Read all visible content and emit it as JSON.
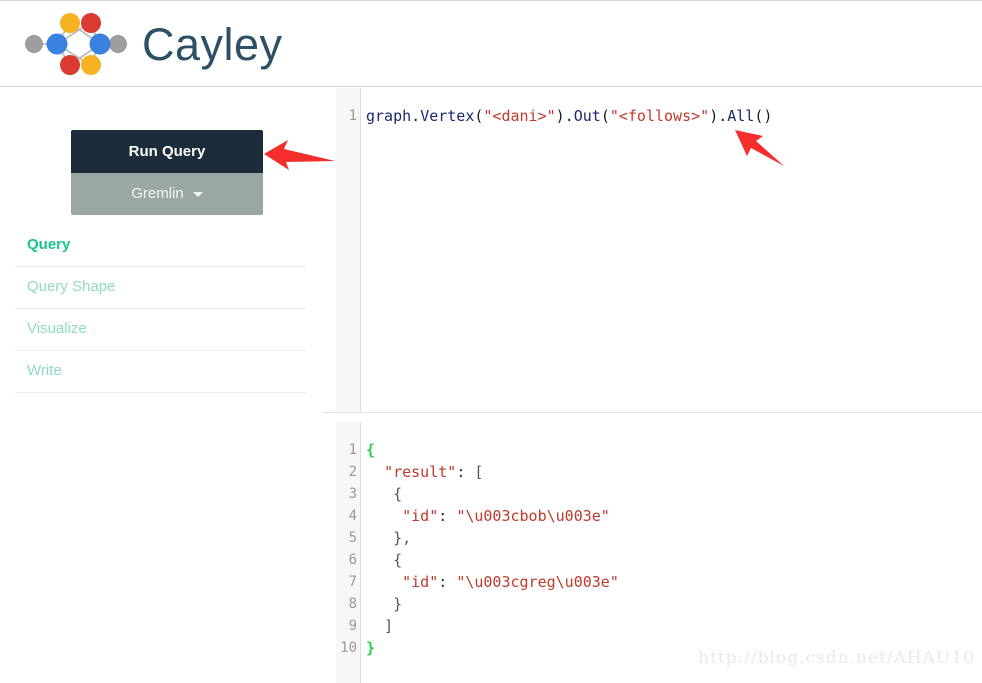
{
  "header": {
    "brand_title": "Cayley",
    "logo_name": "cayley-graph-logo",
    "logo_colors": {
      "blue": "#3b82e0",
      "red": "#d93b30",
      "yellow": "#f5b324",
      "gray": "#9e9e9e",
      "edge": "#b5b5b5"
    }
  },
  "sidebar": {
    "run_query_label": "Run Query",
    "language_label": "Gremlin",
    "language_caret_icon": "chevron-down-icon",
    "nav": [
      {
        "label": "Query",
        "active": true
      },
      {
        "label": "Query Shape",
        "active": false
      },
      {
        "label": "Visualize",
        "active": false
      },
      {
        "label": "Write",
        "active": false
      }
    ]
  },
  "query_editor": {
    "line_numbers": [
      "1"
    ],
    "text": "graph.Vertex(\"<dani>\").Out(\"<follows>\").All()",
    "tokens": [
      {
        "t": "graph",
        "c": "tok-id"
      },
      {
        "t": ".",
        "c": "tok-punc"
      },
      {
        "t": "Vertex",
        "c": "tok-id"
      },
      {
        "t": "(",
        "c": "tok-punc"
      },
      {
        "t": "\"<dani>\"",
        "c": "tok-str"
      },
      {
        "t": ")",
        "c": "tok-punc"
      },
      {
        "t": ".",
        "c": "tok-punc"
      },
      {
        "t": "Out",
        "c": "tok-id"
      },
      {
        "t": "(",
        "c": "tok-punc"
      },
      {
        "t": "\"<follows>\"",
        "c": "tok-str"
      },
      {
        "t": ")",
        "c": "tok-punc"
      },
      {
        "t": ".",
        "c": "tok-punc"
      },
      {
        "t": "All",
        "c": "tok-id"
      },
      {
        "t": "()",
        "c": "tok-punc"
      }
    ]
  },
  "result_editor": {
    "line_numbers": [
      "1",
      "2",
      "3",
      "4",
      "5",
      "6",
      "7",
      "8",
      "9",
      "10"
    ],
    "text": "{\n  \"result\": [\n   {\n    \"id\": \"\\u003cbob\\u003e\"\n   },\n   {\n    \"id\": \"\\u003cgreg\\u003e\"\n   }\n  ]\n}",
    "lines": [
      [
        {
          "t": "{",
          "c": "tok-brace"
        }
      ],
      [
        {
          "t": "  ",
          "c": "tok-plain"
        },
        {
          "t": "\"result\"",
          "c": "tok-str"
        },
        {
          "t": ": ",
          "c": "tok-plain"
        },
        {
          "t": "[",
          "c": "tok-bracket"
        }
      ],
      [
        {
          "t": "   ",
          "c": "tok-plain"
        },
        {
          "t": "{",
          "c": "tok-bracket"
        }
      ],
      [
        {
          "t": "    ",
          "c": "tok-plain"
        },
        {
          "t": "\"id\"",
          "c": "tok-str"
        },
        {
          "t": ": ",
          "c": "tok-plain"
        },
        {
          "t": "\"\\u003cbob\\u003e\"",
          "c": "tok-str"
        }
      ],
      [
        {
          "t": "   ",
          "c": "tok-plain"
        },
        {
          "t": "},",
          "c": "tok-bracket"
        }
      ],
      [
        {
          "t": "   ",
          "c": "tok-plain"
        },
        {
          "t": "{",
          "c": "tok-bracket"
        }
      ],
      [
        {
          "t": "    ",
          "c": "tok-plain"
        },
        {
          "t": "\"id\"",
          "c": "tok-str"
        },
        {
          "t": ": ",
          "c": "tok-plain"
        },
        {
          "t": "\"\\u003cgreg\\u003e\"",
          "c": "tok-str"
        }
      ],
      [
        {
          "t": "   ",
          "c": "tok-plain"
        },
        {
          "t": "}",
          "c": "tok-bracket"
        }
      ],
      [
        {
          "t": "  ",
          "c": "tok-plain"
        },
        {
          "t": "]",
          "c": "tok-bracket"
        }
      ],
      [
        {
          "t": "}",
          "c": "tok-brace"
        }
      ]
    ]
  },
  "annotations": {
    "arrow_color": "#f42d2d",
    "arrow_run_query_name": "arrow-pointing-to-run-query",
    "arrow_query_text_name": "arrow-pointing-to-query-text"
  },
  "watermark": {
    "text": "http://blog.csdn.net/AHAU10"
  }
}
